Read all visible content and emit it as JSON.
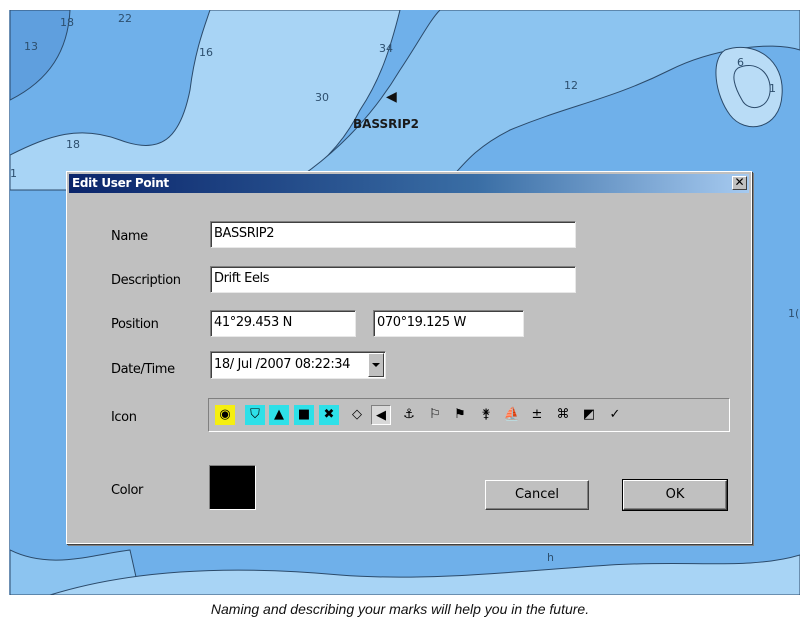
{
  "map": {
    "depths": [
      "18",
      "22",
      "13",
      "16",
      "34",
      "30",
      "12",
      "6",
      "1",
      "18",
      "1"
    ],
    "depth_right": "1(",
    "waypoint_label": "BASSRIP2",
    "waypoint_icon": "fish-icon",
    "lower_mark": "h"
  },
  "dialog": {
    "title": "Edit User Point",
    "close_glyph": "✕",
    "name_label": "Name",
    "name_value": "BASSRIP2",
    "description_label": "Description",
    "description_value": "Drift Eels",
    "position_label": "Position",
    "latitude_value": "41°29.453 N",
    "longitude_value": "070°19.125 W",
    "datetime_label": "Date/Time",
    "datetime_value": "18/ Jul /2007 08:22:34",
    "icon_label": "Icon",
    "icons": [
      {
        "name": "target-icon",
        "glyph": "◉"
      },
      {
        "name": "buoy-icon",
        "glyph": "⛉"
      },
      {
        "name": "beacon-icon",
        "glyph": "▲"
      },
      {
        "name": "can-buoy-icon",
        "glyph": "■"
      },
      {
        "name": "danger-x-icon",
        "glyph": "✖"
      },
      {
        "name": "diamond-icon",
        "glyph": "◇"
      },
      {
        "name": "fish-icon",
        "glyph": "◀"
      },
      {
        "name": "anchor-icon",
        "glyph": "⚓"
      },
      {
        "name": "flag-outline-icon",
        "glyph": "⚐"
      },
      {
        "name": "flag-solid-icon",
        "glyph": "⚑"
      },
      {
        "name": "diver-icon",
        "glyph": "⚵"
      },
      {
        "name": "sailboat-icon",
        "glyph": "⛵"
      },
      {
        "name": "tower-icon",
        "glyph": "±"
      },
      {
        "name": "wreck-icon",
        "glyph": "⌘"
      },
      {
        "name": "square-mark-icon",
        "glyph": "◩"
      },
      {
        "name": "check-mark-icon",
        "glyph": "✓"
      }
    ],
    "color_label": "Color",
    "color_value": "#000000",
    "cancel_label": "Cancel",
    "ok_label": "OK"
  },
  "caption": "Naming and describing your marks will help you in the future."
}
